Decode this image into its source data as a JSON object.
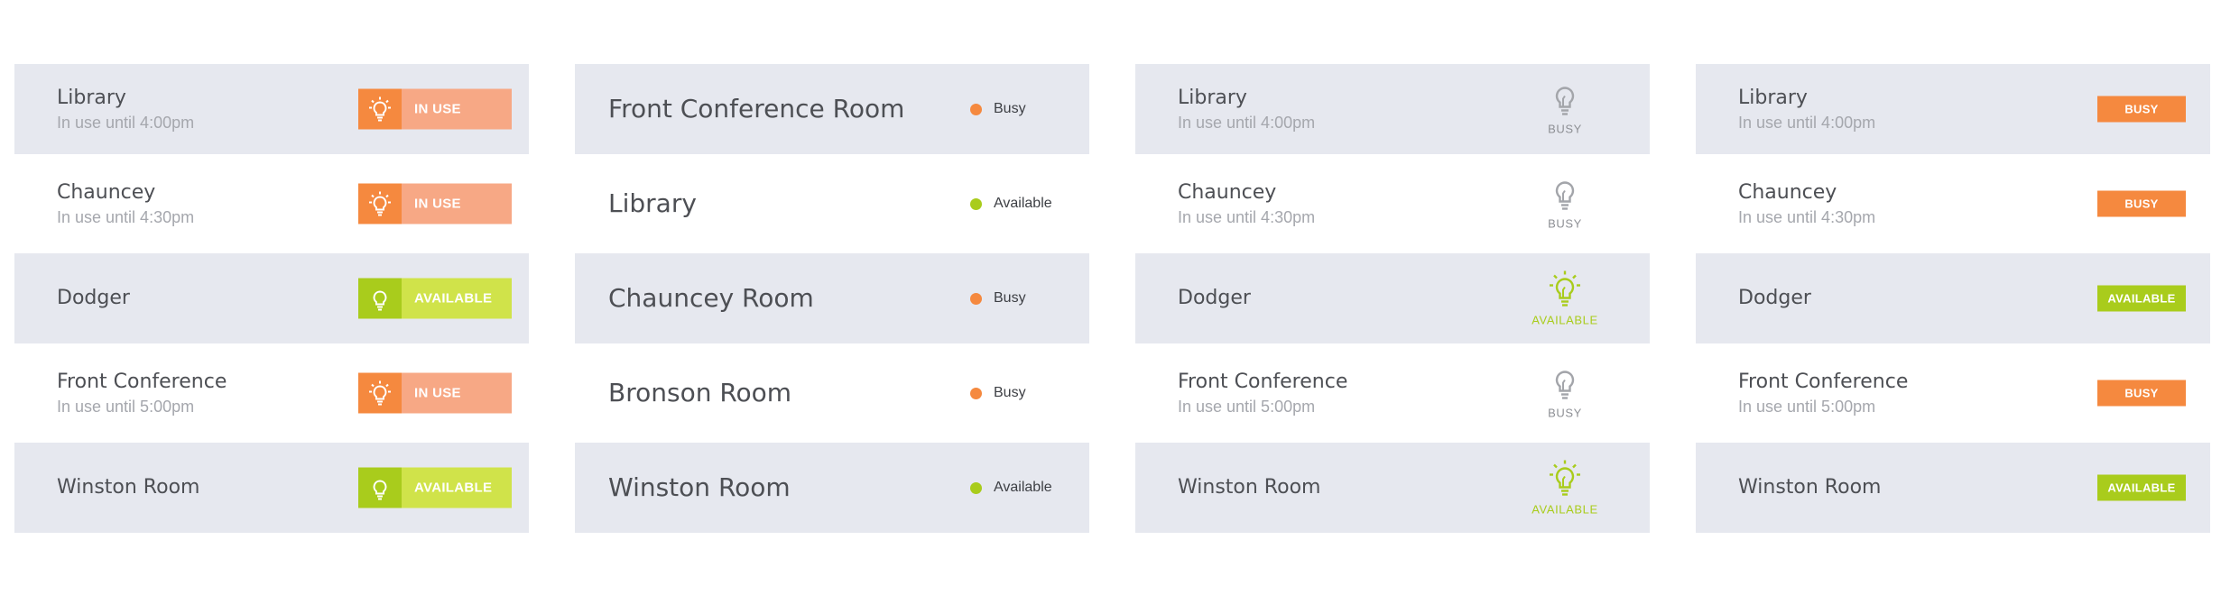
{
  "panel1": {
    "rooms": [
      {
        "name": "Library",
        "sub": "In use until 4:00pm",
        "status": "IN USE"
      },
      {
        "name": "Chauncey",
        "sub": "In use until 4:30pm",
        "status": "IN USE"
      },
      {
        "name": "Dodger",
        "sub": "",
        "status": "AVAILABLE"
      },
      {
        "name": "Front Conference",
        "sub": "In use until 5:00pm",
        "status": "IN USE"
      },
      {
        "name": "Winston Room",
        "sub": "",
        "status": "AVAILABLE"
      }
    ]
  },
  "panel2": {
    "rooms": [
      {
        "name": "Front Conference Room",
        "status": "Busy"
      },
      {
        "name": "Library",
        "status": "Available"
      },
      {
        "name": "Chauncey Room",
        "status": "Busy"
      },
      {
        "name": "Bronson Room",
        "status": "Busy"
      },
      {
        "name": "Winston Room",
        "status": "Available"
      }
    ]
  },
  "panel3": {
    "rooms": [
      {
        "name": "Library",
        "sub": "In use until 4:00pm",
        "status": "BUSY"
      },
      {
        "name": "Chauncey",
        "sub": "In use until 4:30pm",
        "status": "BUSY"
      },
      {
        "name": "Dodger",
        "sub": "",
        "status": "AVAILABLE"
      },
      {
        "name": "Front Conference",
        "sub": "In use until 5:00pm",
        "status": "BUSY"
      },
      {
        "name": "Winston Room",
        "sub": "",
        "status": "AVAILABLE"
      }
    ]
  },
  "panel4": {
    "rooms": [
      {
        "name": "Library",
        "sub": "In use until 4:00pm",
        "status": "BUSY"
      },
      {
        "name": "Chauncey",
        "sub": "In use until 4:30pm",
        "status": "BUSY"
      },
      {
        "name": "Dodger",
        "sub": "",
        "status": "AVAILABLE"
      },
      {
        "name": "Front Conference",
        "sub": "In use until 5:00pm",
        "status": "BUSY"
      },
      {
        "name": "Winston Room",
        "sub": "",
        "status": "AVAILABLE"
      }
    ]
  },
  "colors": {
    "busy": "#f5893f",
    "busy_light": "#f7a885",
    "available": "#a9cc1c",
    "available_light": "#d0e34a",
    "row_shade": "#e6e8ef",
    "bulb_idle": "#a3a5aa"
  },
  "icons": {
    "status_badge": "lightbulb-icon"
  }
}
